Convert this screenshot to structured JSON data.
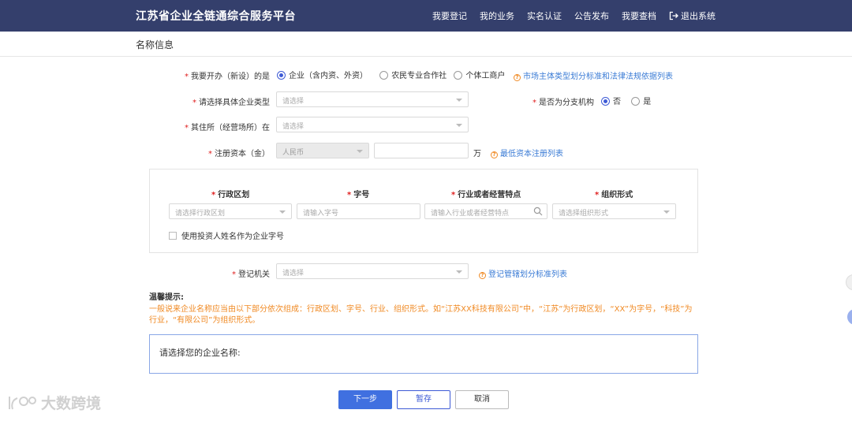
{
  "header": {
    "brand": "江苏省企业全链通综合服务平台",
    "nav": [
      "我要登记",
      "我的业务",
      "实名认证",
      "公告发布",
      "我要查档"
    ],
    "logout": "退出系统"
  },
  "section_title": "名称信息",
  "form": {
    "open_type": {
      "label": "我要开办（新设）的是",
      "options": [
        "企业（含内资、外资）",
        "农民专业合作社",
        "个体工商户"
      ],
      "selected": "企业（含内资、外资）",
      "help_link": "市场主体类型划分标准和法律法规依据列表"
    },
    "enterprise_type": {
      "label": "请选择具体企业类型",
      "placeholder": "请选择"
    },
    "branch": {
      "label": "是否为分支机构",
      "options": [
        "否",
        "是"
      ],
      "selected": "否"
    },
    "residence": {
      "label": "其住所（经营场所）在",
      "placeholder": "请选择"
    },
    "capital": {
      "label": "注册资本（金）",
      "currency": "人民币",
      "amount": "",
      "unit": "万",
      "help_link": "最低资本注册列表"
    },
    "name_parts": {
      "columns": [
        {
          "header": "行政区划",
          "placeholder": "请选择行政区划"
        },
        {
          "header": "字号",
          "placeholder": "请输入字号"
        },
        {
          "header": "行业或者经营特点",
          "placeholder": "请输入行业或者经营特点"
        },
        {
          "header": "组织形式",
          "placeholder": "请选择组织形式"
        }
      ],
      "checkbox": "使用投资人姓名作为企业字号"
    },
    "authority": {
      "label": "登记机关",
      "placeholder": "请选择",
      "help_link": "登记管辖划分标准列表"
    }
  },
  "tips": {
    "title": "温馨提示:",
    "text": "一般说来企业名称应当由以下部分依次组成：行政区划、字号、行业、组织形式。如“江苏XX科技有限公司”中，“江苏”为行政区划，“XX”为字号，“科技”为行业，“有限公司”为组织形式。"
  },
  "name_select_label": "请选择您的企业名称:",
  "buttons": {
    "next": "下一步",
    "save": "暂存",
    "cancel": "取消"
  },
  "watermark": "大数跨境"
}
